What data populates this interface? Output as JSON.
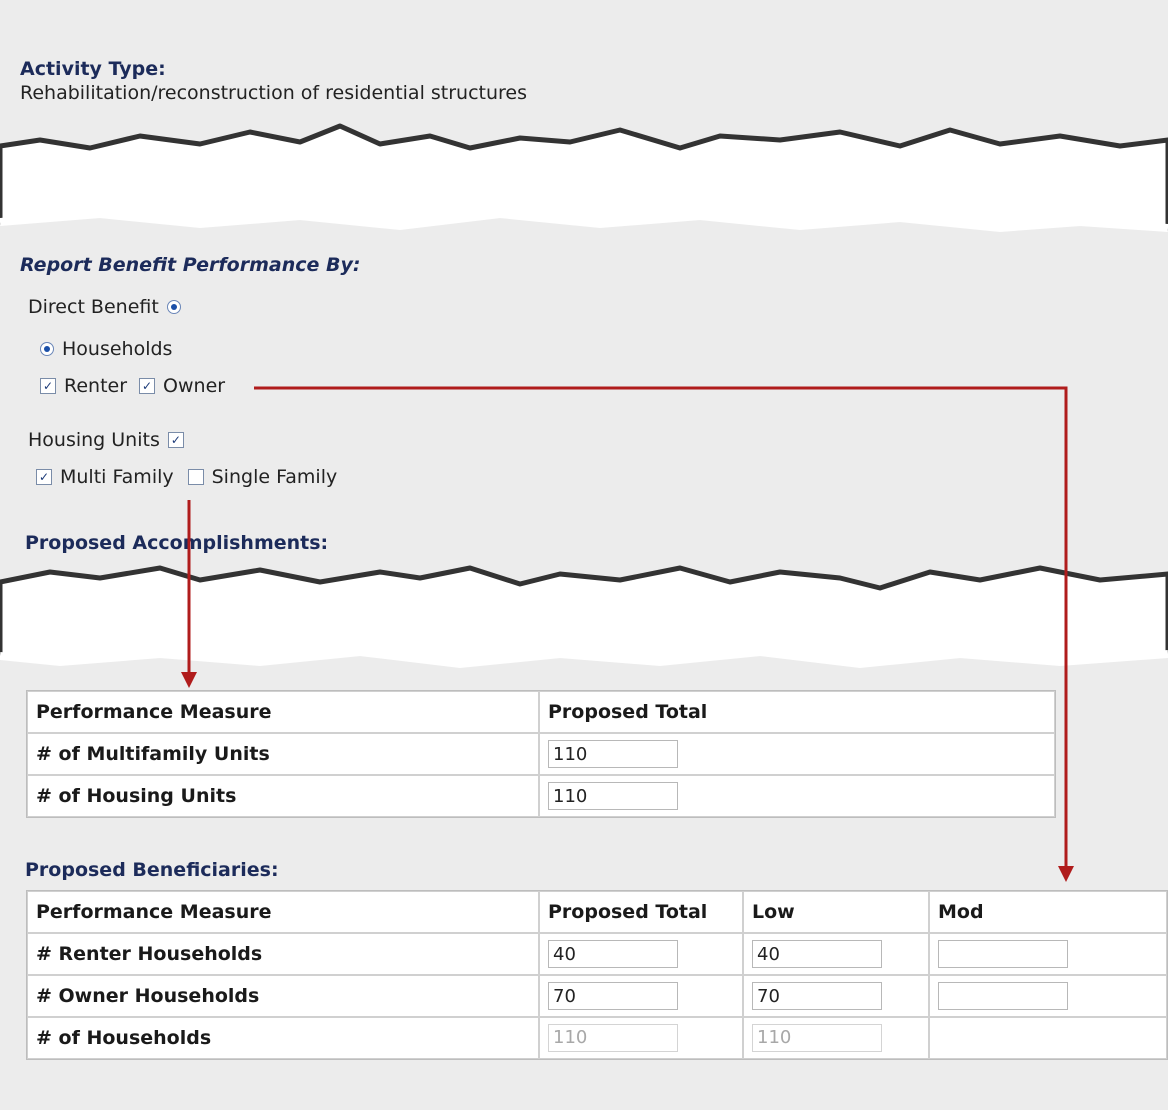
{
  "activity": {
    "label": "Activity Type:",
    "value": "Rehabilitation/reconstruction of residential structures"
  },
  "report_benefit": {
    "title": "Report Benefit Performance By:",
    "direct_benefit": "Direct Benefit",
    "households": "Households",
    "renter": "Renter",
    "owner": "Owner",
    "housing_units": "Housing Units",
    "multi_family": "Multi Family",
    "single_family": "Single Family"
  },
  "accomplishments": {
    "title": "Proposed Accomplishments:",
    "headers": [
      "Performance Measure",
      "Proposed Total"
    ],
    "rows": [
      {
        "label": "# of Multifamily Units",
        "value": "110"
      },
      {
        "label": "# of Housing Units",
        "value": "110"
      }
    ]
  },
  "beneficiaries": {
    "title": "Proposed Beneficiaries:",
    "headers": [
      "Performance Measure",
      "Proposed Total",
      "Low",
      "Mod"
    ],
    "rows": [
      {
        "label": "# Renter Households",
        "total": "40",
        "low": "40",
        "mod": ""
      },
      {
        "label": "# Owner Households",
        "total": "70",
        "low": "70",
        "mod": ""
      },
      {
        "label": "# of Households",
        "total": "110",
        "low": "110",
        "mod": ""
      }
    ]
  },
  "colors": {
    "arrow": "#b01c1c",
    "heading": "#1c2b5a"
  }
}
